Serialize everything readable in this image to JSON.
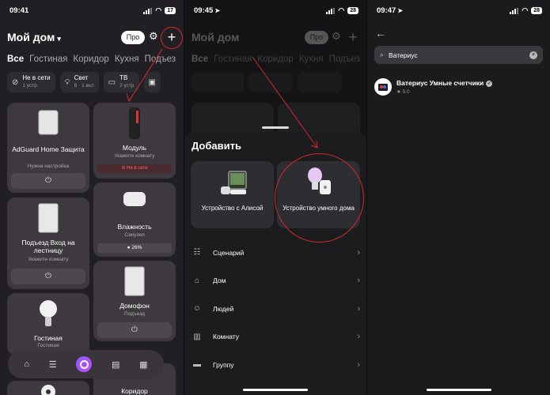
{
  "colors": {
    "accent_red": "#d22a2a",
    "alice_purple": "#8a5bff"
  },
  "screen1": {
    "status": {
      "time": "09:41",
      "battery": "17"
    },
    "home_title": "Мой дом",
    "pro_label": "Про",
    "tabs": [
      "Все",
      "Гостиная",
      "Коридор",
      "Кухня",
      "Подъез"
    ],
    "chips": [
      {
        "icon": "wifi-off-icon",
        "title": "Не в сети",
        "sub": "1 устр"
      },
      {
        "icon": "bulb-icon",
        "title": "Свет",
        "sub": "8 · 1 вкл"
      },
      {
        "icon": "tv-icon",
        "title": "ТВ",
        "sub": "2 устр"
      }
    ],
    "cards": {
      "adguard": {
        "name": "AdGuard Home Защита",
        "sub": "Нужна настройка"
      },
      "module": {
        "name": "Модуль",
        "sub": "Укажите комнату",
        "status": "Не в сети"
      },
      "humidity": {
        "name": "Влажность",
        "sub": "Санузел",
        "value": "26%"
      },
      "entrance": {
        "name": "Подъезд Вход на лестницу",
        "sub": "Укажите комнату"
      },
      "intercom": {
        "name": "Домофон",
        "sub": "Подъезд"
      },
      "living": {
        "name": "Гостиная",
        "sub": "Гостиная"
      },
      "corridor": {
        "name": "Коридор"
      }
    },
    "nav_icons": [
      "home-icon",
      "routines-icon",
      "alice-icon",
      "shop-icon",
      "grid-icon"
    ]
  },
  "screen2": {
    "status": {
      "time": "09:45",
      "battery": "28"
    },
    "home_title": "Мой дом",
    "pro_label": "Про",
    "tabs": [
      "Все",
      "Гостиная",
      "Коридор",
      "Кухня",
      "Подъез"
    ],
    "sheet_title": "Добавить",
    "options": [
      {
        "label": "Устройство с Алисой"
      },
      {
        "label": "Устройство умного дома"
      }
    ],
    "menu": [
      {
        "icon": "scenario-icon",
        "label": "Сценарий"
      },
      {
        "icon": "house-icon",
        "label": "Дом"
      },
      {
        "icon": "people-icon",
        "label": "Людей"
      },
      {
        "icon": "room-icon",
        "label": "Комнату"
      },
      {
        "icon": "folder-icon",
        "label": "Группу"
      }
    ]
  },
  "screen3": {
    "status": {
      "time": "09:47",
      "battery": "28"
    },
    "search_value": "Ватериус",
    "result": {
      "name": "Ватериус Умные счетчики",
      "rating": "5.0"
    }
  }
}
